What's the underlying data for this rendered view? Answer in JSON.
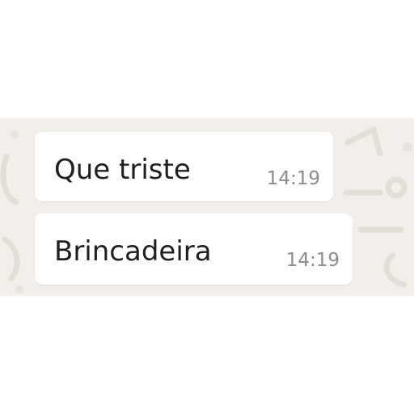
{
  "chat": {
    "background_color": "#f2efea",
    "bubble_color": "#ffffff",
    "messages": [
      {
        "text": "Que triste",
        "time": "14:19"
      },
      {
        "text": "Brincadeira",
        "time": "14:19"
      }
    ]
  }
}
